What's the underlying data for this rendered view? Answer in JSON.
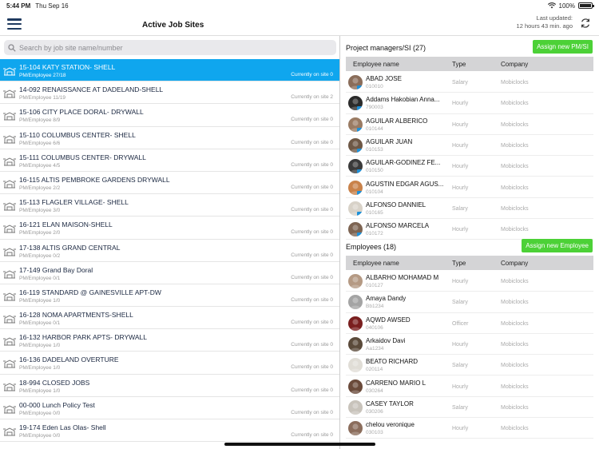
{
  "status_bar": {
    "time": "5:44 PM",
    "date": "Thu Sep 16",
    "battery": "100%"
  },
  "header": {
    "title": "Active Job Sites",
    "last_updated_label": "Last updated:",
    "last_updated_value": "12 hours 43 min. ago"
  },
  "search": {
    "placeholder": "Search by job site name/number"
  },
  "jobs": [
    {
      "name": "15-104 KATY STATION- SHELL",
      "sub": "PM/Employee  27/18",
      "onsite": "Currently on site  0",
      "selected": true
    },
    {
      "name": "14-092 RENAISSANCE AT DADELAND-SHELL",
      "sub": "PM/Employee  11/19",
      "onsite": "Currently on site  2"
    },
    {
      "name": "15-106 CITY PLACE DORAL- DRYWALL",
      "sub": "PM/Employee  8/9",
      "onsite": "Currently on site  0"
    },
    {
      "name": "15-110 COLUMBUS CENTER- SHELL",
      "sub": "PM/Employee  6/6",
      "onsite": "Currently on site  0"
    },
    {
      "name": "15-111 COLUMBUS CENTER- DRYWALL",
      "sub": "PM/Employee  4/5",
      "onsite": "Currently on site  0"
    },
    {
      "name": "16-115 ALTIS PEMBROKE GARDENS DRYWALL",
      "sub": "PM/Employee  2/2",
      "onsite": "Currently on site  0"
    },
    {
      "name": "15-113 FLAGLER VILLAGE- SHELL",
      "sub": "PM/Employee  3/0",
      "onsite": "Currently on site  0"
    },
    {
      "name": "16-121 ELAN MAISON-SHELL",
      "sub": "PM/Employee  2/0",
      "onsite": "Currently on site  0"
    },
    {
      "name": "17-138 ALTIS GRAND CENTRAL",
      "sub": "PM/Employee  0/2",
      "onsite": "Currently on site  0"
    },
    {
      "name": "17-149 Grand Bay Doral",
      "sub": "PM/Employee  0/1",
      "onsite": "Currently on site  0"
    },
    {
      "name": "16-119 STANDARD @ GAINESVILLE APT-DW",
      "sub": "PM/Employee  1/0",
      "onsite": "Currently on site  0"
    },
    {
      "name": "16-128 NOMA APARTMENTS-SHELL",
      "sub": "PM/Employee  0/1",
      "onsite": "Currently on site  0"
    },
    {
      "name": "16-132 HARBOR PARK APTS- DRYWALL",
      "sub": "PM/Employee  1/0",
      "onsite": "Currently on site  0"
    },
    {
      "name": "16-136 DADELAND OVERTURE",
      "sub": "PM/Employee  1/0",
      "onsite": "Currently on site  0"
    },
    {
      "name": "18-994 CLOSED JOBS",
      "sub": "PM/Employee  1/0",
      "onsite": "Currently on site  0"
    },
    {
      "name": "00-000 Lunch Policy Test",
      "sub": "PM/Employee  0/0",
      "onsite": "Currently on site  0"
    },
    {
      "name": "19-174 Eden Las Olas- Shell",
      "sub": "PM/Employee  0/0",
      "onsite": "Currently on site  0"
    }
  ],
  "pm_section": {
    "title": "Project managers/SI  (27)",
    "assign_label": "Assign new PM/SI",
    "columns": [
      "Employee name",
      "Type",
      "Company"
    ],
    "rows": [
      {
        "name": "ABAD JOSE",
        "code": "010010",
        "type": "Salary",
        "company": "Mobiclocks",
        "color": "#8a6d5a"
      },
      {
        "name": "Addams Hakobian Anna...",
        "code": "790003",
        "type": "Hourly",
        "company": "Mobiclocks",
        "color": "#2b2b2b"
      },
      {
        "name": "AGUILAR ALBERICO",
        "code": "010144",
        "type": "Hourly",
        "company": "Mobiclocks",
        "color": "#9a7b63"
      },
      {
        "name": "AGUILAR JUAN",
        "code": "010153",
        "type": "Hourly",
        "company": "Mobiclocks",
        "color": "#6e5846"
      },
      {
        "name": "AGUILAR-GODINEZ FE...",
        "code": "010150",
        "type": "Hourly",
        "company": "Mobiclocks",
        "color": "#3a3a3a"
      },
      {
        "name": "AGUSTIN EDGAR AGUS...",
        "code": "010104",
        "type": "Hourly",
        "company": "Mobiclocks",
        "color": "#c9824a"
      },
      {
        "name": "ALFONSO DANNIEL",
        "code": "010165",
        "type": "Salary",
        "company": "Mobiclocks",
        "color": "#d8d2c8"
      },
      {
        "name": "ALFONSO MARCELA",
        "code": "010172",
        "type": "Hourly",
        "company": "Mobiclocks",
        "color": "#7d6452"
      }
    ]
  },
  "emp_section": {
    "title": "Employees  (18)",
    "assign_label": "Assign new Employee",
    "columns": [
      "Employee name",
      "Type",
      "Company"
    ],
    "rows": [
      {
        "name": "ALBARHO MOHAMAD M",
        "code": "010127",
        "type": "Hourly",
        "company": "Mobiclocks",
        "color": "#b59a84"
      },
      {
        "name": "Amaya Dandy",
        "code": "Bb1234",
        "type": "Salary",
        "company": "Mobiclocks",
        "color": "#a4a4a4"
      },
      {
        "name": "AQWD AWSED",
        "code": "040106",
        "type": "Officer",
        "company": "Mobiclocks",
        "color": "#7a1f1f"
      },
      {
        "name": "Arkaidov Davi",
        "code": "Aa1234",
        "type": "Hourly",
        "company": "Mobiclocks",
        "color": "#5a4a3a"
      },
      {
        "name": "BEATO RICHARD",
        "code": "020114",
        "type": "Salary",
        "company": "Mobiclocks",
        "color": "#e0ddd6"
      },
      {
        "name": "CARRENO MARIO L",
        "code": "030264",
        "type": "Hourly",
        "company": "Mobiclocks",
        "color": "#6a4a3a"
      },
      {
        "name": "CASEY TAYLOR",
        "code": "030206",
        "type": "Salary",
        "company": "Mobiclocks",
        "color": "#c8c3bb"
      },
      {
        "name": "chelou veronique",
        "code": "030103",
        "type": "Hourly",
        "company": "Mobiclocks",
        "color": "#8b6d5c"
      }
    ]
  },
  "colors": {
    "accent": "#0fa6ee",
    "green": "#4cd137",
    "table_head": "#d4d4d6"
  },
  "icons": [
    "hamburger-icon",
    "refresh-icon",
    "search-icon",
    "job-site-icon",
    "wifi-icon",
    "battery-icon"
  ]
}
